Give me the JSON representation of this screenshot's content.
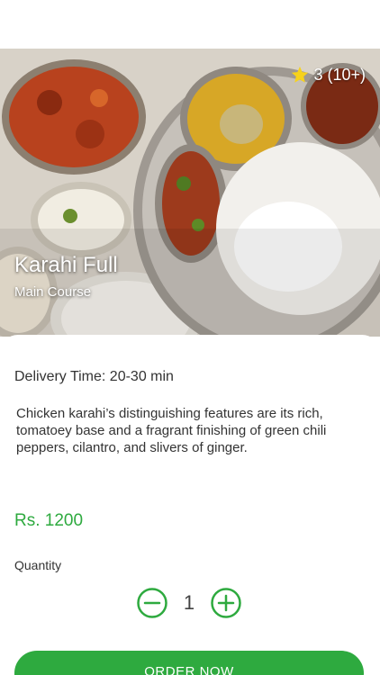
{
  "dish": {
    "rating_text": "3 (10+)",
    "name": "Karahi Full",
    "category": "Main Course",
    "delivery_time": "Delivery Time: 20-30 min",
    "description": "Chicken karahi’s distinguishing features are its rich, tomatoey base and a fragrant finishing of green chili peppers, cilantro, and slivers of ginger.",
    "price": "Rs. 1200"
  },
  "quantity": {
    "label": "Quantity",
    "value": "1"
  },
  "order_button": {
    "label": "ORDER NOW"
  },
  "icons": {
    "rating": "star-icon",
    "decrease": "minus-circle-icon",
    "increase": "plus-circle-icon"
  },
  "colors": {
    "accent": "#2eaa3f",
    "star": "#f7d21b"
  }
}
